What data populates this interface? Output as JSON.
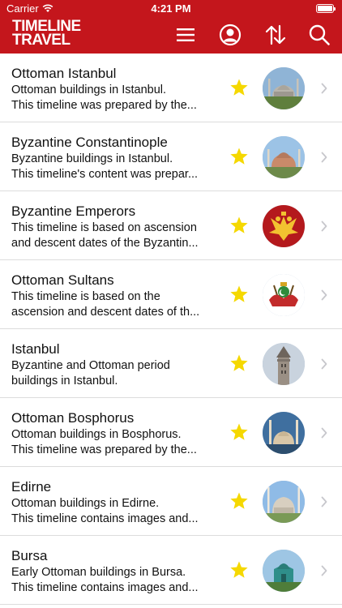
{
  "status": {
    "carrier": "Carrier",
    "time": "4:21 PM"
  },
  "header": {
    "brand_line1": "TIMELINE",
    "brand_line2": "TRAVEL",
    "icons": [
      "menu-icon",
      "profile-icon",
      "sort-icon",
      "search-icon"
    ]
  },
  "colors": {
    "header_bg": "#c4161c",
    "star": "#f5d800",
    "divider": "#dcdcdc"
  },
  "timelines": [
    {
      "title": "Ottoman Istanbul",
      "desc1": "Ottoman buildings in Istanbul.",
      "desc2": "This timeline was prepared by the...",
      "favorite": true,
      "thumb": "mosque-photo"
    },
    {
      "title": "Byzantine Constantinople",
      "desc1": "Byzantine buildings in Istanbul.",
      "desc2": "This timeline's content was prepar...",
      "favorite": true,
      "thumb": "hagia-sophia-photo"
    },
    {
      "title": "Byzantine Emperors",
      "desc1": "This timeline is based on ascension",
      "desc2": "and descent dates of the Byzantin...",
      "favorite": true,
      "thumb": "double-headed-eagle-emblem"
    },
    {
      "title": "Ottoman Sultans",
      "desc1": "This timeline is based on the",
      "desc2": "ascension and descent dates of th...",
      "favorite": true,
      "thumb": "ottoman-coat-of-arms"
    },
    {
      "title": "Istanbul",
      "desc1": "Byzantine and Ottoman period",
      "desc2": "buildings in Istanbul.",
      "favorite": true,
      "thumb": "galata-tower-photo"
    },
    {
      "title": "Ottoman Bosphorus",
      "desc1": "Ottoman buildings in Bosphorus.",
      "desc2": "This timeline was prepared by the...",
      "favorite": true,
      "thumb": "bosphorus-mosque-photo"
    },
    {
      "title": "Edirne",
      "desc1": "Ottoman buildings in Edirne.",
      "desc2": "This timeline contains images and...",
      "favorite": true,
      "thumb": "selimiye-mosque-photo"
    },
    {
      "title": "Bursa",
      "desc1": "Early Ottoman buildings in Bursa.",
      "desc2": "This timeline contains images and...",
      "favorite": true,
      "thumb": "green-tomb-photo"
    }
  ]
}
